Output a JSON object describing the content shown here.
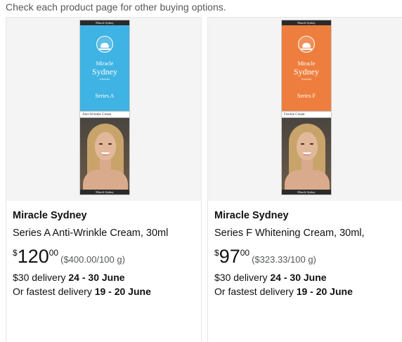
{
  "notice": "Check each product page for other buying options.",
  "products": [
    {
      "package": {
        "top_band": "Miracle Sydney",
        "brand_line1": "Miracle",
        "brand_line2": "Sydney",
        "brand_line3": "Australia",
        "series": "Series A",
        "label": "Anti-Wrinkle Cream",
        "bottom_band": "Miracle Sydney",
        "panel_color": "#3fb3e3"
      },
      "brand": "Miracle Sydney",
      "title": "Series A Anti-Wrinkle Cream, 30ml",
      "price": {
        "symbol": "$",
        "whole": "120",
        "fraction": "00",
        "unit_price": "($400.00/100 g)"
      },
      "delivery": {
        "prefix": "$30 delivery ",
        "dates": "24 - 30 June"
      },
      "fastest": {
        "prefix": "Or fastest delivery ",
        "dates": "19 - 20 June"
      }
    },
    {
      "package": {
        "top_band": "Miracle Sydney",
        "brand_line1": "Miracle",
        "brand_line2": "Sydney",
        "brand_line3": "Australia",
        "series": "Series F",
        "label": "Freckle Cream",
        "bottom_band": "Miracle Sydney",
        "panel_color": "#ee7e3e"
      },
      "brand": "Miracle Sydney",
      "title": "Series F Whitening Cream, 30ml,",
      "price": {
        "symbol": "$",
        "whole": "97",
        "fraction": "00",
        "unit_price": "($323.33/100 g)"
      },
      "delivery": {
        "prefix": "$30 delivery ",
        "dates": "24 - 30 June"
      },
      "fastest": {
        "prefix": "Or fastest delivery ",
        "dates": "19 - 20 June"
      }
    }
  ]
}
